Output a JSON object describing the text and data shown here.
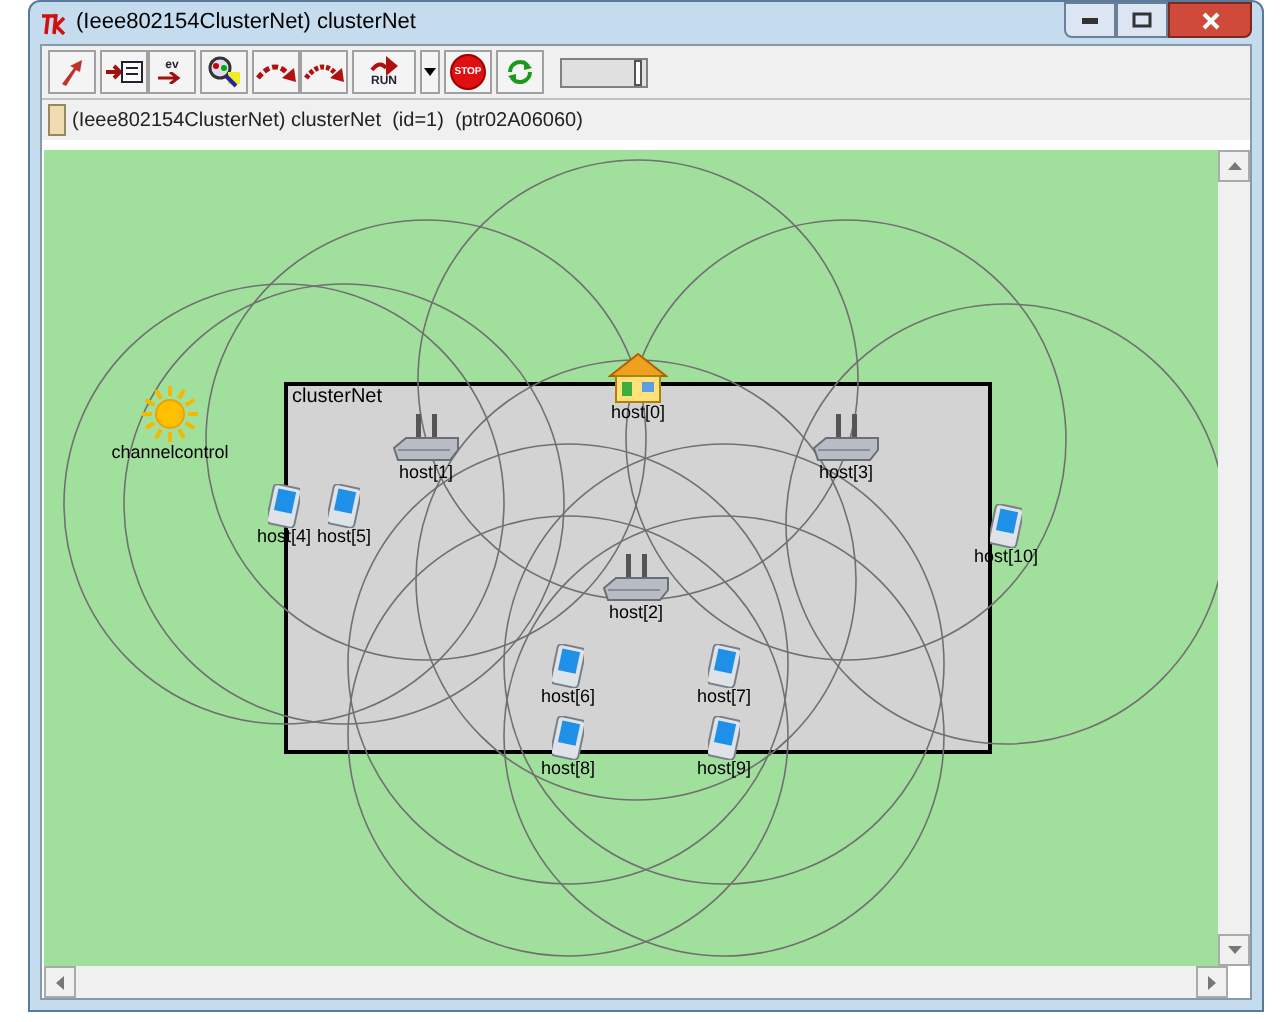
{
  "window": {
    "title": "(Ieee802154ClusterNet) clusterNet"
  },
  "toolbar": {
    "buttons": [
      {
        "kind": "up"
      },
      {
        "kind": "module"
      },
      {
        "kind": "events",
        "label": "ev"
      },
      {
        "kind": "inspect"
      },
      {
        "kind": "step"
      },
      {
        "kind": "fast"
      },
      {
        "kind": "run",
        "label": "RUN"
      },
      {
        "kind": "dropdown"
      },
      {
        "kind": "stop",
        "label": "STOP"
      },
      {
        "kind": "refresh"
      }
    ],
    "speed": {
      "level": 0.95
    }
  },
  "info_bar": {
    "text": "(Ieee802154ClusterNet) clusterNet  (id=1)  (ptr02A06060)"
  },
  "canvas": {
    "network_label": "clusterNet",
    "nodes": [
      {
        "kind": "sun",
        "label": "channelcontrol"
      },
      {
        "kind": "house",
        "label": "host[0]"
      },
      {
        "kind": "router",
        "label": "host[1]"
      },
      {
        "kind": "router",
        "label": "host[3]"
      },
      {
        "kind": "pda",
        "label": "host[4]"
      },
      {
        "kind": "pda",
        "label": "host[5]"
      },
      {
        "kind": "pda",
        "label": "host[10]"
      },
      {
        "kind": "router",
        "label": "host[2]"
      },
      {
        "kind": "pda",
        "label": "host[6]"
      },
      {
        "kind": "pda",
        "label": "host[7]"
      },
      {
        "kind": "pda",
        "label": "host[8]"
      },
      {
        "kind": "pda",
        "label": "host[9]"
      }
    ]
  }
}
